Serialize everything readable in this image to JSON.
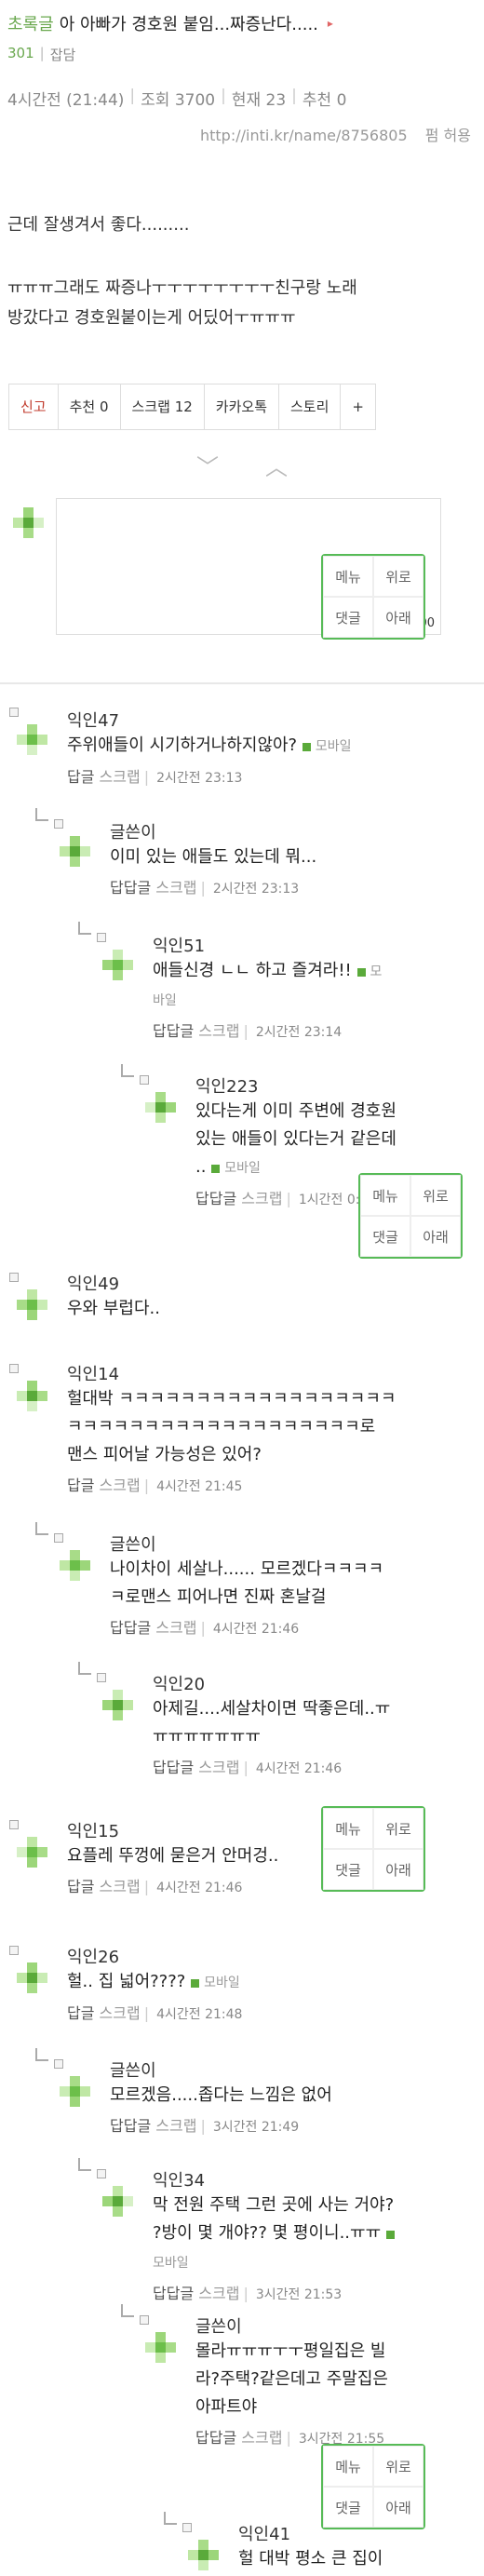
{
  "header": {
    "category": "초록글",
    "title": "아 아빠가 경호원 붙임...짜증난다.....",
    "number": "301",
    "board": "잡담"
  },
  "meta": {
    "time": "4시간전 (21:44)",
    "views": "조회 3700",
    "current": "현재 23",
    "recommend": "추천 0",
    "url": "http://inti.kr/name/8756805",
    "permission": "펌 허용"
  },
  "body": {
    "line1": "근데 잘생겨서 좋다.........",
    "line2": "ㅠㅠㅠ그래도 짜증나ㅜㅜㅜㅜㅜㅜㅜㅜ친구랑 노래",
    "line3": "방갔다고 경호원붙이는게 어딨어ㅜㅠㅠㅠ"
  },
  "buttons": {
    "report": "신고",
    "recommend": "추천 0",
    "scrap": "스크랩 12",
    "kakao": "카카오톡",
    "story": "스토리",
    "plus": "+"
  },
  "arrows": {
    "down": "﹀",
    "up": "︿"
  },
  "comment_box": {
    "counter": "1500"
  },
  "popup": {
    "menu": "메뉴",
    "up": "위로",
    "comments": "댓글",
    "down": "아래"
  },
  "labels": {
    "reply": "답글",
    "reply2": "답답글",
    "scrap": "스크랩",
    "mobile": "모바일"
  },
  "comments": [
    {
      "nick": "익인47",
      "text": "주위애들이 시기하거나하지않아?",
      "time": "2시간전 23:13"
    },
    {
      "nick": "글쓴이",
      "text": "이미 있는 애들도 있는데 뭐...",
      "time": "2시간전 23:13"
    },
    {
      "nick": "익인51",
      "text": "애들신경 ㄴㄴ 하고 즐겨라!!",
      "mobile": "모",
      "mobile2": "바일",
      "time": "2시간전 23:14"
    },
    {
      "nick": "익인223",
      "text1": "있다는게 이미 주변에 경호원",
      "text2": "있는 애들이 있다는거 같은데",
      "text3": "..",
      "time": "1시간전 0:41"
    },
    {
      "nick": "익인49",
      "text": "우와 부럽다.."
    },
    {
      "nick": "익인14",
      "text1": "헐대박 ㅋㅋㅋㅋㅋㅋㅋㅋㅋㅋㅋㅋㅋㅋㅋㅋㅋㅋ",
      "text2": "ㅋㅋㅋㅋㅋㅋㅋㅋㅋㅋㅋㅋㅋㅋㅋㅋㅋㅋㅋ로",
      "text3": "맨스 피어날 가능성은 있어?",
      "time": "4시간전 21:45"
    },
    {
      "nick": "글쓴이",
      "text1": "나이차이 세살나...... 모르겠다ㅋㅋㅋㅋ",
      "text2": "ㅋ로맨스 피어나면 진짜 혼날걸",
      "time": "4시간전 21:46"
    },
    {
      "nick": "익인20",
      "text1": "아제길....세살차이면 딱좋은데..ㅠ",
      "text2": "ㅠㅠㅠㅠㅠㅠㅠ",
      "time": "4시간전 21:46"
    },
    {
      "nick": "익인15",
      "text": "요플레 뚜껑에 묻은거 안머겅..",
      "time": "4시간전 21:46"
    },
    {
      "nick": "익인26",
      "text": "헐.. 집 넓어????",
      "time": "4시간전 21:48"
    },
    {
      "nick": "글쓴이",
      "text": "모르겠음.....좁다는 느낌은 없어",
      "time": "3시간전 21:49"
    },
    {
      "nick": "익인34",
      "text1": "막 전원 주택 그런 곳에 사는 거야?",
      "text2": "?방이 몇 개야?? 몇 평이니..ㅠㅠ",
      "time": "3시간전 21:53"
    },
    {
      "nick": "글쓴이",
      "text1": "몰라ㅠㅠㅠㅜㅜ평일집은 빌",
      "text2": "라?주택?같은데고 주말집은",
      "text3": "아파트야",
      "time": "3시간전 21:55"
    },
    {
      "nick": "익인41",
      "text": "헐 대박 평소 큰 집이"
    }
  ],
  "colors": {
    "accent": "#5aaa3a",
    "popup_border": "#57bb57"
  }
}
